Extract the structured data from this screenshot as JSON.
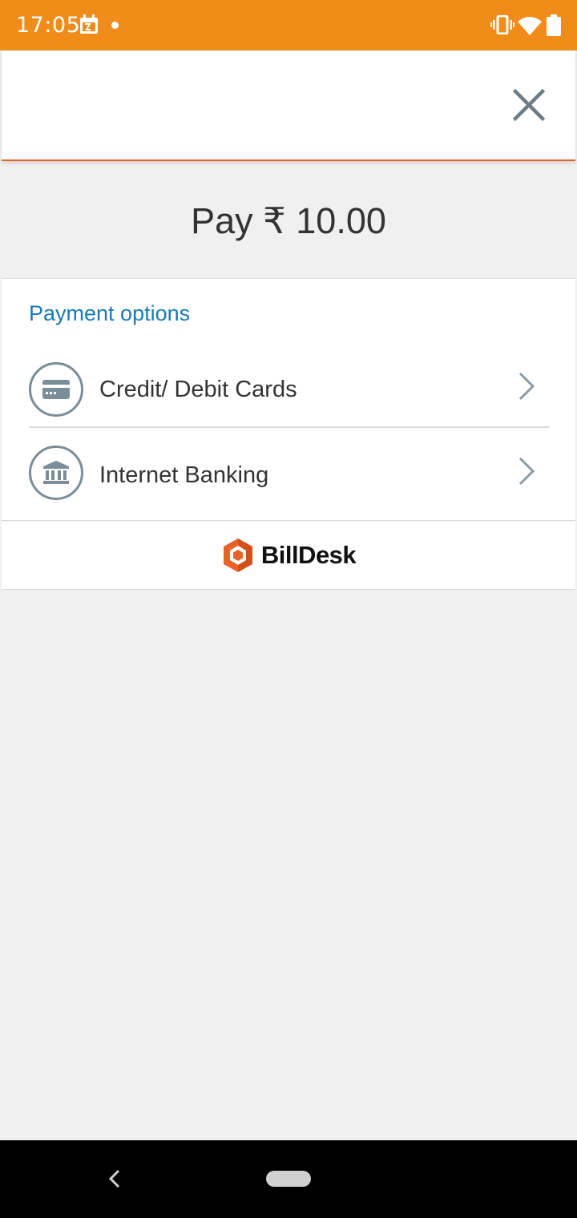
{
  "status_bar": {
    "time": "17:05",
    "background": "#f08c1a"
  },
  "header": {
    "close_icon": "close-icon"
  },
  "payment": {
    "amount_text": "Pay ₹ 10.00"
  },
  "options": {
    "title": "Payment options",
    "items": [
      {
        "label": "Credit/ Debit Cards",
        "icon": "credit-card-icon"
      },
      {
        "label": "Internet Banking",
        "icon": "bank-icon"
      }
    ]
  },
  "footer": {
    "brand": "BillDesk",
    "brand_accent": "#e8622a"
  },
  "colors": {
    "accent": "#1a7ab8",
    "header_underline": "#e8622a"
  }
}
